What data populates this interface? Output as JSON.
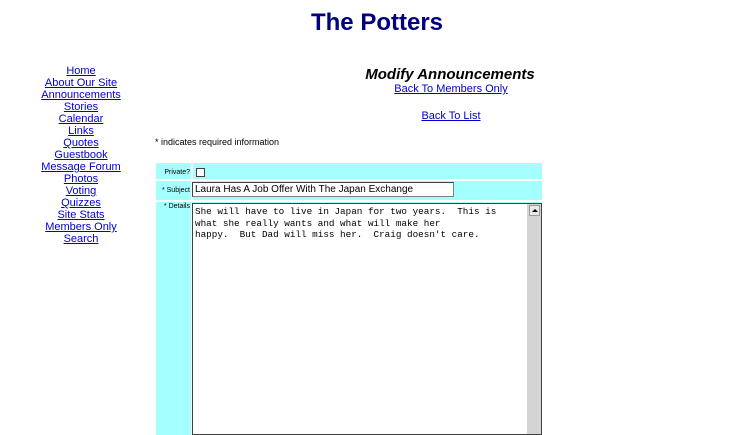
{
  "site": {
    "title": "The Potters"
  },
  "nav": {
    "items": [
      {
        "label": "Home"
      },
      {
        "label": "About Our Site"
      },
      {
        "label": "Announcements"
      },
      {
        "label": "Stories"
      },
      {
        "label": "Calendar"
      },
      {
        "label": "Links"
      },
      {
        "label": "Quotes"
      },
      {
        "label": "Guestbook"
      },
      {
        "label": "Message Forum"
      },
      {
        "label": "Photos"
      },
      {
        "label": "Voting"
      },
      {
        "label": "Quizzes"
      },
      {
        "label": "Site Stats"
      },
      {
        "label": "Members Only"
      },
      {
        "label": "Search"
      }
    ]
  },
  "main": {
    "heading": "Modify Announcements",
    "back_members": "Back To Members Only",
    "back_list": "Back To List",
    "required_note": "* indicates required information"
  },
  "form": {
    "private_label": "Private?",
    "private_checked": false,
    "subject_label": "* Subject",
    "subject_value": "Laura Has  A Job Offer With The Japan Exchange",
    "details_label": "* Details",
    "details_value": "She will have to live in Japan for two years.  This is\nwhat she really wants and what will make her\nhappy.  But Dad will miss her.  Craig doesn't care."
  },
  "colors": {
    "form_bg": "#a4ffff",
    "title": "#000080",
    "link": "#0000cc"
  }
}
